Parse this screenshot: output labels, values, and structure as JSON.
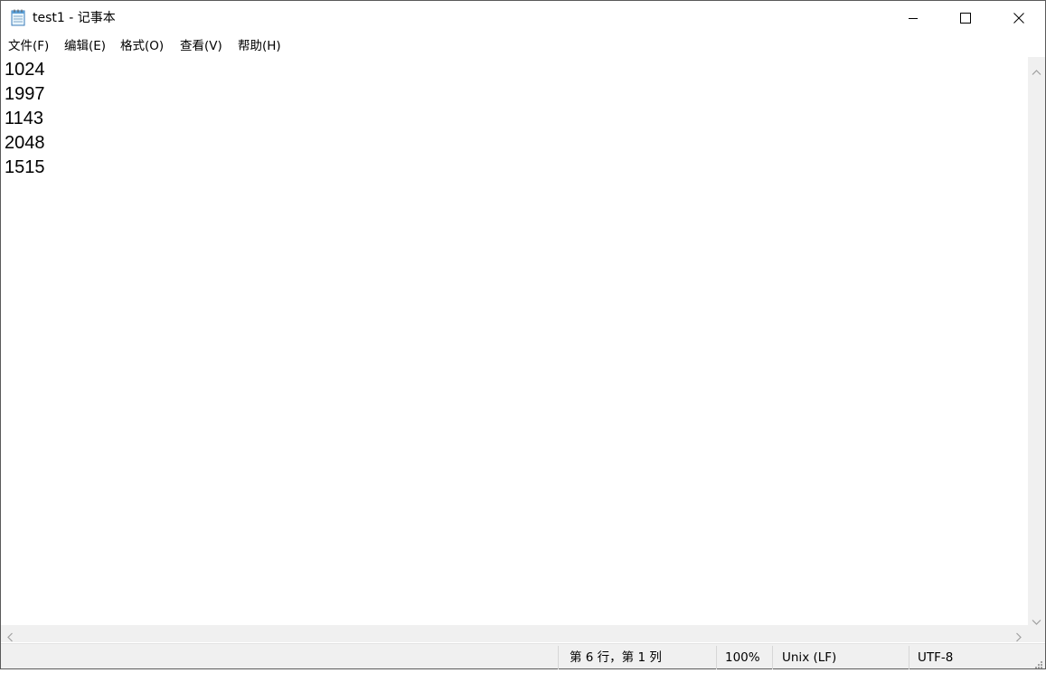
{
  "window": {
    "title": "test1 - 记事本"
  },
  "menu": [
    {
      "label": "文件(F)"
    },
    {
      "label": "编辑(E)"
    },
    {
      "label": "格式(O)"
    },
    {
      "label": "查看(V)"
    },
    {
      "label": "帮助(H)"
    }
  ],
  "editor": {
    "lines": [
      "1024",
      "1997",
      "1143",
      "2048",
      "1515"
    ]
  },
  "status": {
    "position": "第 6 行，第 1 列",
    "zoom": "100%",
    "line_ending": "Unix (LF)",
    "encoding": "UTF-8"
  },
  "icons": {
    "app": "notepad-icon",
    "minimize": "minimize-icon",
    "maximize": "maximize-icon",
    "close": "close-icon"
  }
}
